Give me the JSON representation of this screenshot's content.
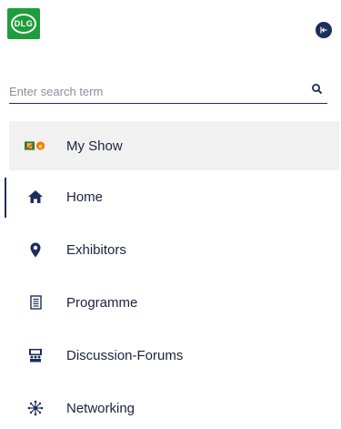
{
  "header": {
    "logo_text": "DLG",
    "collapse_button_icon": "collapse-left-icon"
  },
  "search": {
    "placeholder": "Enter search term",
    "value": "",
    "icon": "search-icon"
  },
  "menu": {
    "items": [
      {
        "label": "My Show",
        "icon": "myshow-logo-icon",
        "highlighted": true
      },
      {
        "label": "Home",
        "icon": "home-icon",
        "active": true
      },
      {
        "label": "Exhibitors",
        "icon": "map-pin-icon"
      },
      {
        "label": "Programme",
        "icon": "document-list-icon"
      },
      {
        "label": "Discussion-Forums",
        "icon": "forum-stage-icon"
      },
      {
        "label": "Networking",
        "icon": "network-icon"
      }
    ]
  },
  "colors": {
    "brand_green": "#1f9d3a",
    "navy": "#1d2e5c",
    "highlight_bg": "#f1f1f2"
  }
}
